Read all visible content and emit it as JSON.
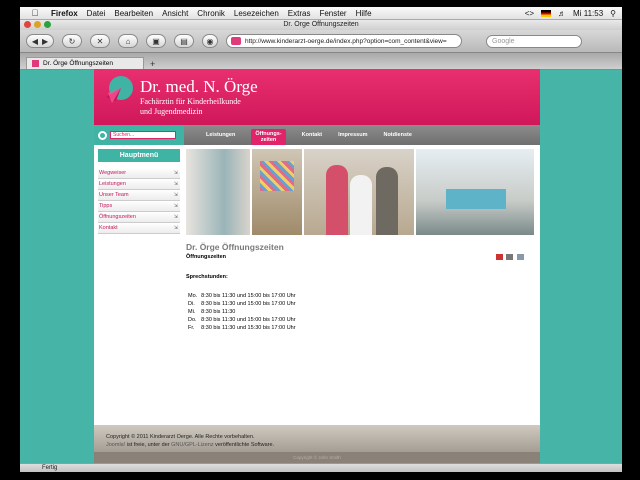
{
  "menubar": {
    "app": "Firefox",
    "items": [
      "Datei",
      "Bearbeiten",
      "Ansicht",
      "Chronik",
      "Lesezeichen",
      "Extras",
      "Fenster",
      "Hilfe"
    ],
    "clock": "Mi 11:53"
  },
  "window": {
    "title": "Dr. Örge Öffnungszeiten"
  },
  "toolbar": {
    "url": "http://www.kinderarzt-oerge.de/index.php?option=com_content&view=",
    "search_placeholder": "Google"
  },
  "tab": {
    "label": "Dr. Örge Öffnungszeiten",
    "new_tab": "+"
  },
  "site": {
    "title": "Dr. med. N. Örge",
    "subtitle_line1": "Fachärztin für Kinderheilkunde",
    "subtitle_line2": "und Jugendmedizin",
    "search_placeholder": "Suchen...",
    "nav": [
      {
        "label": "Leistungen"
      },
      {
        "label": "Öffnungs-"
      },
      {
        "label": "zeiten"
      },
      {
        "label": "Kontakt"
      },
      {
        "label": "Impressum"
      },
      {
        "label": "Notdienste"
      }
    ],
    "menu_heading": "Hauptmenü",
    "side_menu": [
      "Wegweiser",
      "Leistungen",
      "Unser Team",
      "Tipps",
      "Öffnungszeiten",
      "Kontakt"
    ]
  },
  "article": {
    "title": "Dr. Örge Öffnungszeiten",
    "subtitle": "Öffnungszeiten",
    "hours_heading": "Sprechstunden:",
    "hours": [
      {
        "day": "Mo.",
        "time": "8:30 bis 11:30 und 15:00 bis 17:00 Uhr"
      },
      {
        "day": "Di.",
        "time": "8:30 bis 11:30 und 15:00 bis 17:00 Uhr"
      },
      {
        "day": "Mi.",
        "time": "8:30 bis 11:30"
      },
      {
        "day": "Do.",
        "time": "8:30 bis 11:30 und 15:00 bis 17:00 Uhr"
      },
      {
        "day": "Fr.",
        "time": "8:30 bis 11:30 und 15:30 bis 17:00 Uhr"
      }
    ]
  },
  "footer": {
    "copyright": "Copyright © 2011 Kinderarzt Oerge. Alle Rechte vorbehalten.",
    "joomla": "Joomla!",
    "license_text": "ist freie, unter der",
    "license": "GNU/GPL-Lizenz",
    "license_tail": "veröffentlichte Software.",
    "bottom": "Copyright © John Smith"
  },
  "status": {
    "text": "Fertig"
  },
  "colors": {
    "brand_pink": "#e0236a",
    "teal": "#46b5a7"
  }
}
